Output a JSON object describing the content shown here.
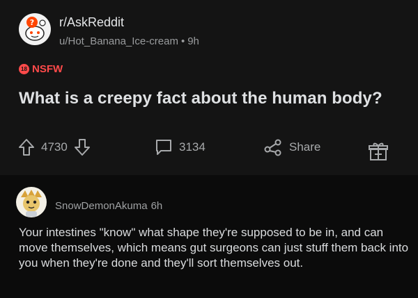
{
  "post": {
    "subreddit": "r/AskReddit",
    "author": "u/Hot_Banana_Ice-cream",
    "age": "9h",
    "nsfw_label": "NSFW",
    "nsfw_badge": "18",
    "title": "What is a creepy fact about the human body?",
    "upvotes": "4730",
    "comment_count": "3134",
    "share_label": "Share"
  },
  "comment": {
    "author": "SnowDemonAkuma",
    "age": "6h",
    "text": "Your intestines \"know\" what shape they're supposed to be in, and can move themselves, which means gut surgeons can just stuff them back into you when they're done and they'll sort themselves out."
  },
  "colors": {
    "background": "#0b0b0b",
    "card": "#141414",
    "nsfw": "#ff4a4a",
    "muted_text": "#9a9c9e"
  },
  "icons": [
    "subreddit-avatar-icon",
    "upvote-icon",
    "downvote-icon",
    "comment-icon",
    "share-icon",
    "award-icon",
    "user-avatar-icon"
  ]
}
